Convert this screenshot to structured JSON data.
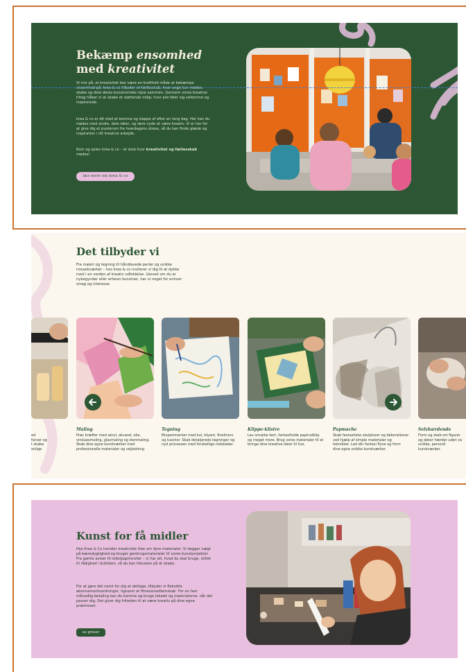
{
  "hero": {
    "title_part1": "Bekæmp ",
    "title_part2": "ensomhed",
    "title_part3": "med ",
    "title_part4": "kreativitet",
    "paragraph1": "Vi tror på, at kreativitet kan være en kraftfuld måde at bekæmpe ensomhed på. krea & co tilbyder et fællesskab, hvor unge kan mødes, skabe og dele deres kunstneriske rejse sammen. Gennem vores kreative tiltag håber vi at skabe et støttende miljø, hvor alle føler sig velkomne og inspirerede.",
    "paragraph2": "krea & co er dit sted at komme og slappe af efter en lang dag. Her kan du mødes med andre, dele idéer, og lære nyde at være kreativ. Vi er her for at give dig et pusterum fra hverdagens stress, så du kan finde glæde og inspiration i dit kreative arbejde.",
    "paragraph3_start": "Kom og oplev krea & co – et sted hvor ",
    "paragraph3_bold": "kreativitet og fællesskab",
    "paragraph3_end": " mødes!",
    "button_label": "læs mere om krea & co"
  },
  "offers": {
    "title": "Det tilbyder vi",
    "intro": "Fra maleri og tegning til håndlavede perler og unikke mosaikværker – hos krea & co inviterer vi dig til at dykke med i en verden af kreativ udfoldelse. Uanset om du er nybegynder eller erfaren kunstner, har vi noget for enhver smag og interesse.",
    "partial_left": "ed\n farver og\nt skabe\nonlige",
    "cards": [
      {
        "title": "Maling",
        "desc": "Prøv kræfter med akryl, akvarel, olie, vinduesmaling, glasmaling og stenmaling. Skab dine egne kunstværker med professionelle materialer og vejledning."
      },
      {
        "title": "Tegning",
        "desc": "Eksperimenter med kul, blyant, fineliners og tuscher. Skab detaljerede tegninger og nyd processen med forskellige redskaber."
      },
      {
        "title": "Klippe-klistre",
        "desc": "Lav smukke kort, fantasifulde papirudklip og meget mere. Brug vores materialer til at bringe dine kreative ideer til live."
      },
      {
        "title": "Papmache",
        "desc": "Skab fantastiske skulpturer og dekorationer ved hjælp af simple materialer og teknikker. Lad din fantasi flyve og form dine egne unikke kunstværker."
      },
      {
        "title": "Selvhærdende",
        "desc": "Form og skab sm figurer og dekor hærder uden ov unikke, personli kunstværker."
      }
    ]
  },
  "kunst": {
    "title": "Kunst for få midler",
    "paragraph1": "Hos Krea & Co handler kreativitet ikke om dyre materialer. Vi lægger vægt på bæredygtighed og bruger genbrugsmaterialer til vores kunstprojekter. Fra gamle aviser til toiletpapirsruller – vi har alt, hvad du skal bruge, stillet til rådighed i butikken, så du kan fokusere på at skabe.",
    "paragraph2": "For at gøre det nemt for dig at deltage, tilbyder vi fleksible abonnementsordninger, ligesom et fitnessmedlemskab. For en fast månedlig betaling kan du komme og bruge lokalet og materialerne, når det passer dig. Det giver dig friheden til at være kreativ på dine egne præmisser.",
    "button_label": "se priser"
  },
  "colors": {
    "green": "#2c5634",
    "pink": "#e9bfdf",
    "cream": "#fbf6ee",
    "frame": "#c8722f",
    "guide": "#3f7fd0"
  },
  "icons": {
    "prev": "arrow-left-icon",
    "next": "arrow-right-icon"
  }
}
